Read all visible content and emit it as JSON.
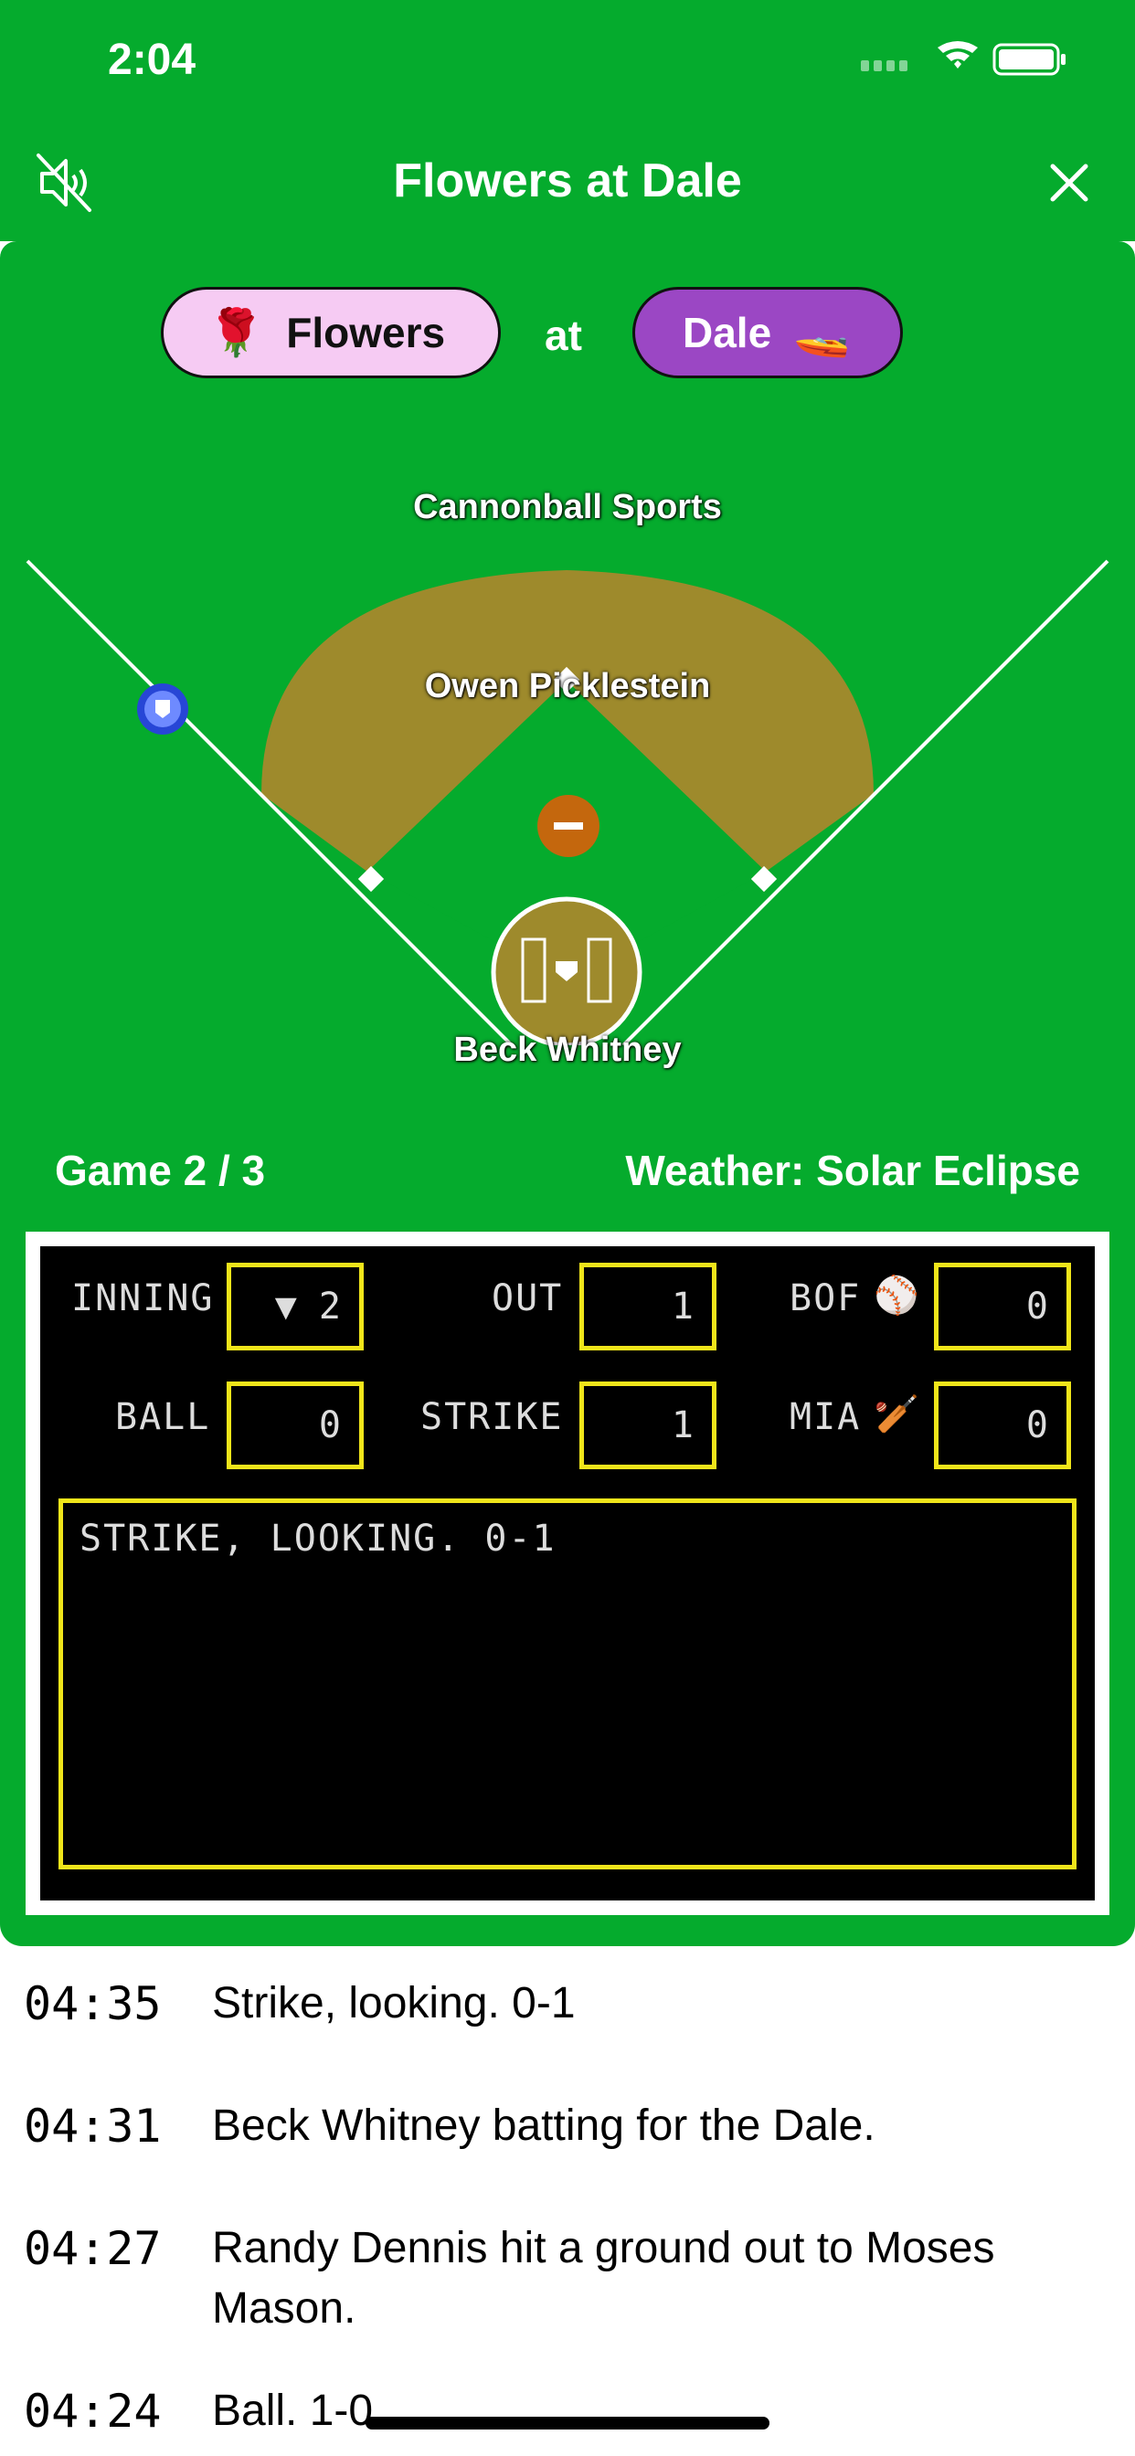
{
  "status": {
    "time": "2:04"
  },
  "nav": {
    "title": "Flowers at Dale"
  },
  "teams": {
    "away": {
      "emoji": "🌹",
      "name": "Flowers"
    },
    "at": "at",
    "home": {
      "name": "Dale",
      "emoji": "🚤"
    }
  },
  "field": {
    "top_label": "Cannonball Sports",
    "pitcher": "Owen Picklestein",
    "batter": "Beck Whitney",
    "pitcher_badge": "−"
  },
  "game": {
    "game_label": "Game 2 / 3",
    "weather_label": "Weather: Solar Eclipse"
  },
  "scoreboard": {
    "inning_label": "INNING",
    "inning_value": "▼ 2",
    "out_label": "OUT",
    "out_value": "1",
    "away_abbr": "BOF",
    "away_icon": "⚾",
    "away_score": "0",
    "ball_label": "BALL",
    "ball_value": "0",
    "strike_label": "STRIKE",
    "strike_value": "1",
    "home_abbr": "MIA",
    "home_icon": "🏏",
    "home_score": "0",
    "message": "STRIKE, LOOKING. 0-1"
  },
  "log": [
    {
      "time": "04:35",
      "text": "Strike, looking. 0-1"
    },
    {
      "time": "04:31",
      "text": "Beck Whitney batting for the Dale."
    },
    {
      "time": "04:27",
      "text": "Randy Dennis hit a ground out to Moses Mason."
    },
    {
      "time": "04:24",
      "text": "Ball. 1-0"
    }
  ]
}
